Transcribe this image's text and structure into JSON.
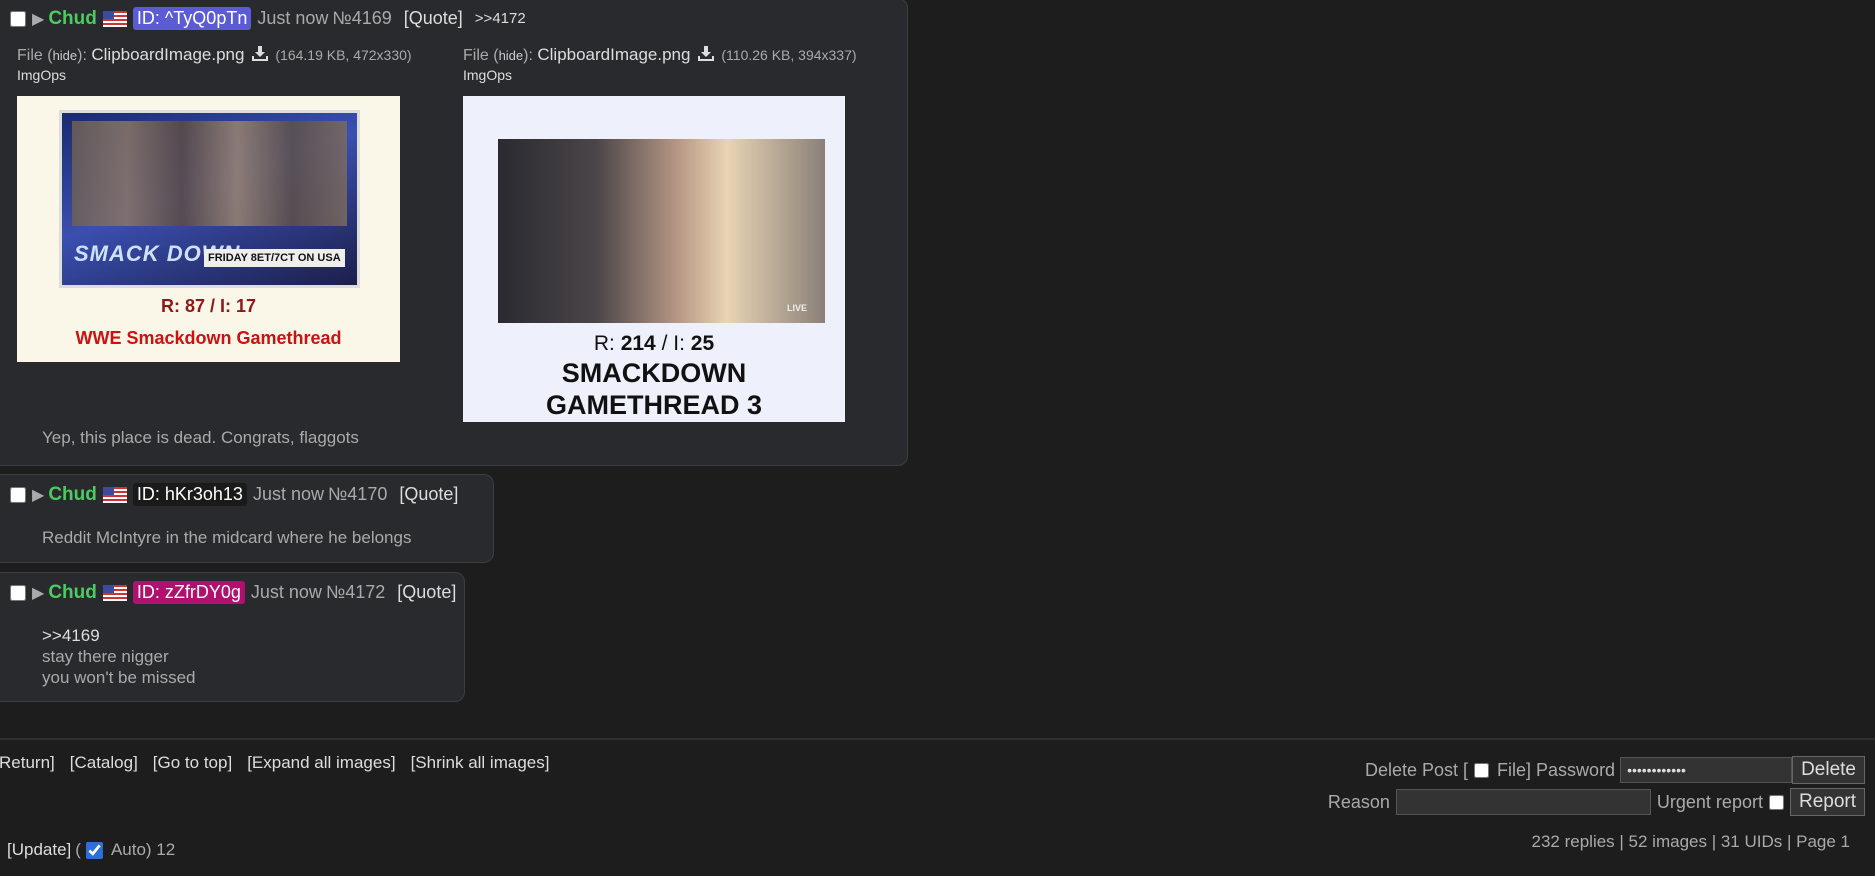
{
  "colors": {
    "name": "#4ccb5f",
    "uid_1": "#5b5bd6",
    "uid_2": "#1a1a1a",
    "uid_3": "#b0116e"
  },
  "posts": [
    {
      "name": "Chud",
      "flag_icon": "us-flag-icon",
      "uid": "ID: ^TyQ0pTn",
      "time": "Just now",
      "number": "№4169",
      "quote_label": "[Quote]",
      "backlink": ">>4172",
      "files": [
        {
          "prefix": "File (",
          "hide": "hide",
          "mid": "): ",
          "filename": "ClipboardImage.png",
          "download_icon": "download-icon",
          "meta": "(164.19 KB, 472x330)",
          "imgops": "ImgOps",
          "thumb_stats": "R: 87 / I: 17",
          "thumb_title": "WWE Smackdown Gamethread",
          "thumb_banner": "SMACK DOWN",
          "thumb_sub": "FRIDAY 8ET/7CT ON USA"
        },
        {
          "prefix": "File (",
          "hide": "hide",
          "mid": "): ",
          "filename": "ClipboardImage.png",
          "download_icon": "download-icon",
          "meta": "(110.26 KB, 394x337)",
          "imgops": "ImgOps",
          "thumb_stats_r": "R: ",
          "thumb_stats_rv": "214",
          "thumb_stats_i": " / I: ",
          "thumb_stats_iv": "25",
          "thumb_title_1": "SMACKDOWN",
          "thumb_title_2": "GAMETHREAD 3",
          "thumb_live": "LIVE"
        }
      ],
      "message": "Yep, this place is dead. Congrats, flaggots"
    },
    {
      "name": "Chud",
      "flag_icon": "us-flag-icon",
      "uid": "ID: hKr3oh13",
      "time": "Just now",
      "number": "№4170",
      "quote_label": "[Quote]",
      "message": "Reddit McIntyre in the midcard where he belongs"
    },
    {
      "name": "Chud",
      "flag_icon": "us-flag-icon",
      "uid": "ID: zZfrDY0g",
      "time": "Just now",
      "number": "№4172",
      "quote_label": "[Quote]",
      "message_quote": ">>4169",
      "message_lines": [
        "stay there nigger",
        "you won't be missed"
      ]
    }
  ],
  "footer": {
    "links": [
      "Return]",
      "[Catalog]",
      "[Go to top]",
      "[Expand all images]",
      "[Shrink all images]"
    ],
    "delete_post_label": "Delete Post [",
    "file_label": "File] Password",
    "password_value": "••••••••••••",
    "delete_button": "Delete",
    "reason_label": "Reason",
    "reason_value": "",
    "urgent_label": "Urgent report",
    "report_button": "Report",
    "update_label": "[Update]",
    "auto_open": "(",
    "auto_label": "Auto) 12",
    "stats": "232 replies | 52 images | 31 UIDs | Page 1"
  }
}
